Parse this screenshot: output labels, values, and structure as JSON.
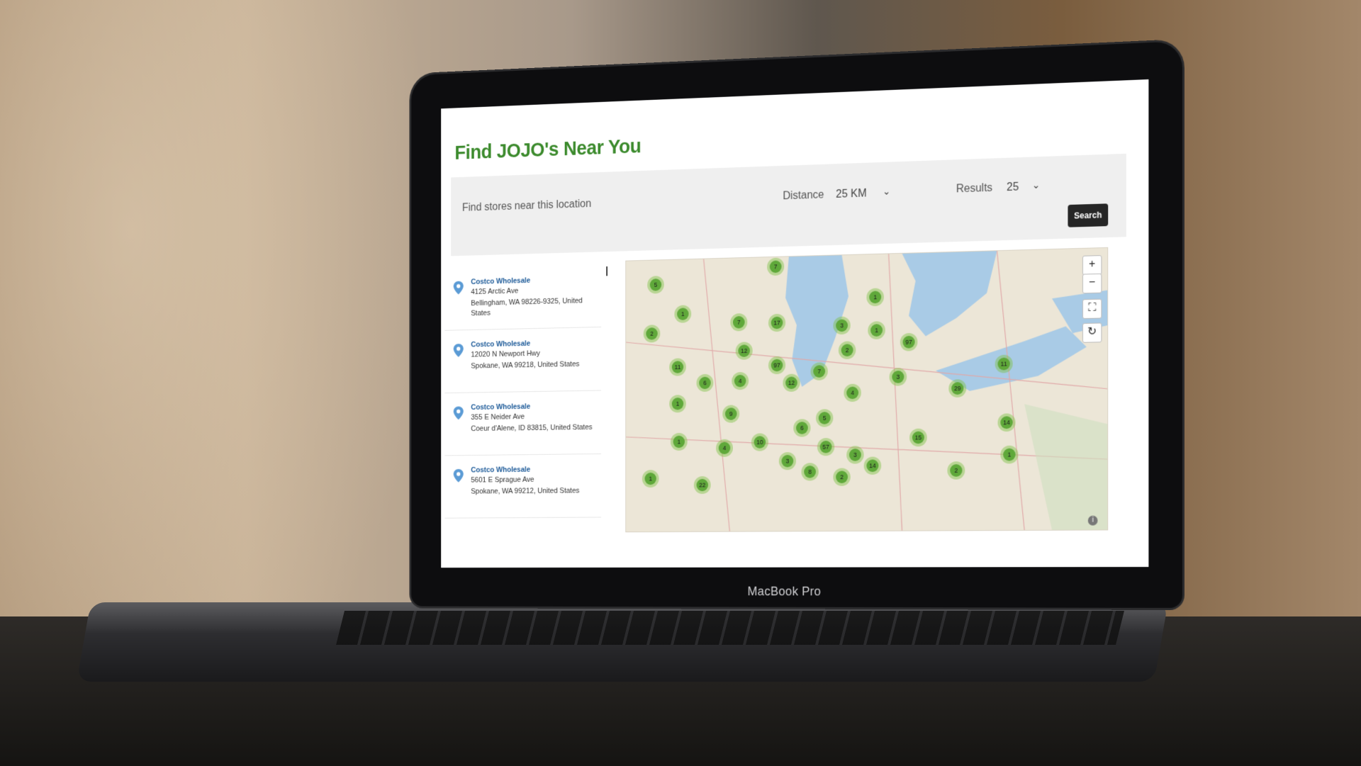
{
  "page": {
    "title": "Find JOJO's Near You"
  },
  "search": {
    "location_placeholder": "Find stores near this location",
    "distance_label": "Distance",
    "distance_value": "25 KM",
    "results_label": "Results",
    "results_value": "25",
    "button_label": "Search"
  },
  "stores": [
    {
      "name": "Costco Wholesale",
      "street": "4125 Arctic Ave",
      "city": "Bellingham, WA 98226-9325, United States"
    },
    {
      "name": "Costco Wholesale",
      "street": "12020 N Newport Hwy",
      "city": "Spokane, WA 99218, United States"
    },
    {
      "name": "Costco Wholesale",
      "street": "355 E Neider Ave",
      "city": "Coeur d'Alene, ID 83815, United States"
    },
    {
      "name": "Costco Wholesale",
      "street": "5601 E Sprague Ave",
      "city": "Spokane, WA 99212, United States"
    }
  ],
  "map": {
    "zoom_in": "+",
    "zoom_out": "−",
    "fullscreen": "⛶",
    "reset": "↻",
    "info": "i",
    "clusters": [
      "5",
      "7",
      "1",
      "2",
      "7",
      "17",
      "3",
      "1",
      "12",
      "97",
      "2",
      "1",
      "97",
      "11",
      "6",
      "4",
      "12",
      "7",
      "3",
      "4",
      "1",
      "9",
      "29",
      "11",
      "6",
      "5",
      "1",
      "10",
      "14",
      "15",
      "57",
      "4",
      "3",
      "3",
      "14",
      "8",
      "2",
      "2",
      "1",
      "22",
      "1"
    ]
  },
  "device": {
    "brand": "MacBook Pro"
  },
  "colors": {
    "title": "#3b8a2c",
    "link": "#1e5b99",
    "cluster": "#7cc242"
  }
}
